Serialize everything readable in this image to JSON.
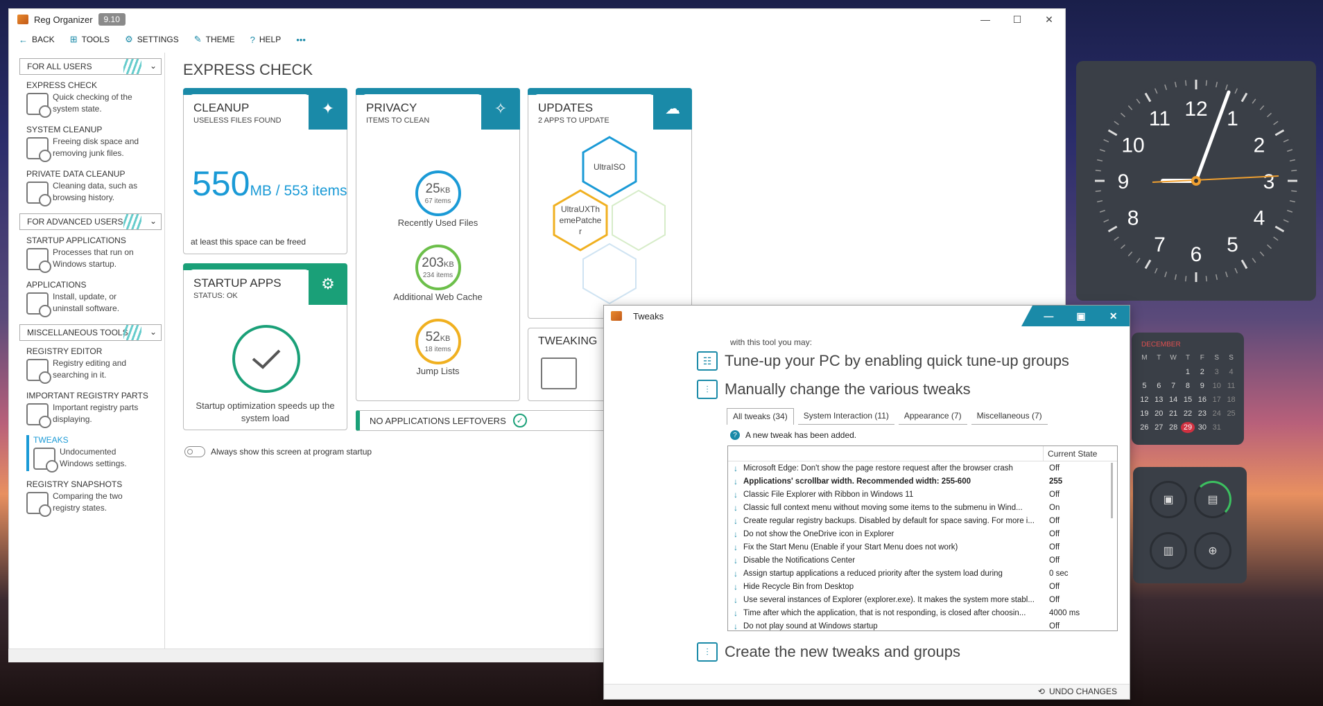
{
  "app": {
    "title": "Reg Organizer",
    "version": "9.10",
    "window_controls": [
      "—",
      "☐",
      "✕"
    ]
  },
  "toolbar": {
    "back": "BACK",
    "tools": "TOOLS",
    "settings": "SETTINGS",
    "theme": "THEME",
    "help": "HELP",
    "more": "•••"
  },
  "sidebar": {
    "sections": {
      "all_users": "FOR ALL USERS",
      "advanced": "FOR ADVANCED USERS",
      "misc": "MISCELLANEOUS TOOLS"
    },
    "items": [
      {
        "title": "EXPRESS CHECK",
        "desc": "Quick checking of the system state."
      },
      {
        "title": "SYSTEM CLEANUP",
        "desc": "Freeing disk space and removing junk files."
      },
      {
        "title": "PRIVATE DATA CLEANUP",
        "desc": "Cleaning data, such as browsing history."
      },
      {
        "title": "STARTUP APPLICATIONS",
        "desc": "Processes that run on Windows startup."
      },
      {
        "title": "APPLICATIONS",
        "desc": "Install, update, or uninstall software."
      },
      {
        "title": "REGISTRY EDITOR",
        "desc": "Registry editing and searching in it."
      },
      {
        "title": "IMPORTANT REGISTRY PARTS",
        "desc": "Important registry parts displaying."
      },
      {
        "title": "TWEAKS",
        "desc": "Undocumented Windows settings."
      },
      {
        "title": "REGISTRY SNAPSHOTS",
        "desc": "Comparing the two registry states."
      }
    ]
  },
  "main": {
    "title": "EXPRESS CHECK",
    "cleanup": {
      "title": "CLEANUP",
      "sub": "USELESS FILES FOUND",
      "big": "550",
      "unit": "MB / 553 items",
      "note": "at least this space can be freed"
    },
    "privacy": {
      "title": "PRIVACY",
      "sub": "ITEMS TO CLEAN",
      "rings": [
        {
          "value": "25",
          "unit": "KB",
          "items": "67 items",
          "label": "Recently Used Files",
          "color": "#1a9ad6"
        },
        {
          "value": "203",
          "unit": "KB",
          "items": "234 items",
          "label": "Additional Web Cache",
          "color": "#6cbf4a"
        },
        {
          "value": "52",
          "unit": "KB",
          "items": "18 items",
          "label": "Jump Lists",
          "color": "#f0b020"
        }
      ]
    },
    "updates": {
      "title": "UPDATES",
      "sub": "2 APPS TO UPDATE",
      "hex1": "UltraISO",
      "hex2": "UltraUXThemePatcher"
    },
    "startup": {
      "title": "STARTUP APPS",
      "sub": "STATUS: OK",
      "note": "Startup optimization speeds up the system load"
    },
    "tweaking": {
      "title": "TWEAKING"
    },
    "leftovers": "NO APPLICATIONS LEFTOVERS",
    "always_show": "Always show this screen at program startup"
  },
  "tweaks": {
    "window_title": "Tweaks",
    "intro": "with this tool you may:",
    "h1": "Tune-up your PC by enabling quick tune-up groups",
    "h2": "Manually change the various tweaks",
    "h3": "Create the new tweaks and groups",
    "tabs": [
      "All tweaks (34)",
      "System Interaction (11)",
      "Appearance (7)",
      "Miscellaneous (7)"
    ],
    "notice": "A new tweak has been added.",
    "col_state": "Current State",
    "rows": [
      {
        "name": "Microsoft Edge: Don't show the page restore request after the browser crash",
        "state": "Off"
      },
      {
        "name": "Applications' scrollbar width. Recommended width: 255-600",
        "state": "255"
      },
      {
        "name": "Classic File Explorer with Ribbon in Windows 11",
        "state": "Off"
      },
      {
        "name": "Classic full context menu without moving some items to the submenu in Wind...",
        "state": "On"
      },
      {
        "name": "Create regular registry backups. Disabled by default for space saving. For more i...",
        "state": "Off"
      },
      {
        "name": "Do not show the OneDrive icon in Explorer",
        "state": "Off"
      },
      {
        "name": "Fix the Start Menu (Enable if your Start Menu does not work)",
        "state": "Off"
      },
      {
        "name": "Disable the Notifications Center",
        "state": "Off"
      },
      {
        "name": "Assign startup applications a reduced priority after the system load during",
        "state": "0 sec"
      },
      {
        "name": "Hide Recycle Bin from Desktop",
        "state": "Off"
      },
      {
        "name": "Use several instances of Explorer (explorer.exe). It makes the system more stabl...",
        "state": "Off"
      },
      {
        "name": "Time after which the application, that is not responding, is closed after choosin...",
        "state": "4000 ms"
      },
      {
        "name": "Do not play sound at Windows startup",
        "state": "Off"
      }
    ],
    "undo": "UNDO CHANGES"
  },
  "widgets": {
    "clock_numbers": [
      "12",
      "1",
      "2",
      "3",
      "4",
      "5",
      "6",
      "7",
      "8",
      "9",
      "10",
      "11"
    ],
    "calendar": {
      "month": "DECEMBER",
      "headers": [
        "M",
        "T",
        "W",
        "T",
        "F",
        "S",
        "S"
      ],
      "days": [
        "",
        "",
        "",
        "1",
        "2",
        "3",
        "4",
        "5",
        "6",
        "7",
        "8",
        "9",
        "10",
        "11",
        "12",
        "13",
        "14",
        "15",
        "16",
        "17",
        "18",
        "19",
        "20",
        "21",
        "22",
        "23",
        "24",
        "25",
        "26",
        "27",
        "28",
        "29",
        "30",
        "31"
      ],
      "today": "29"
    }
  }
}
